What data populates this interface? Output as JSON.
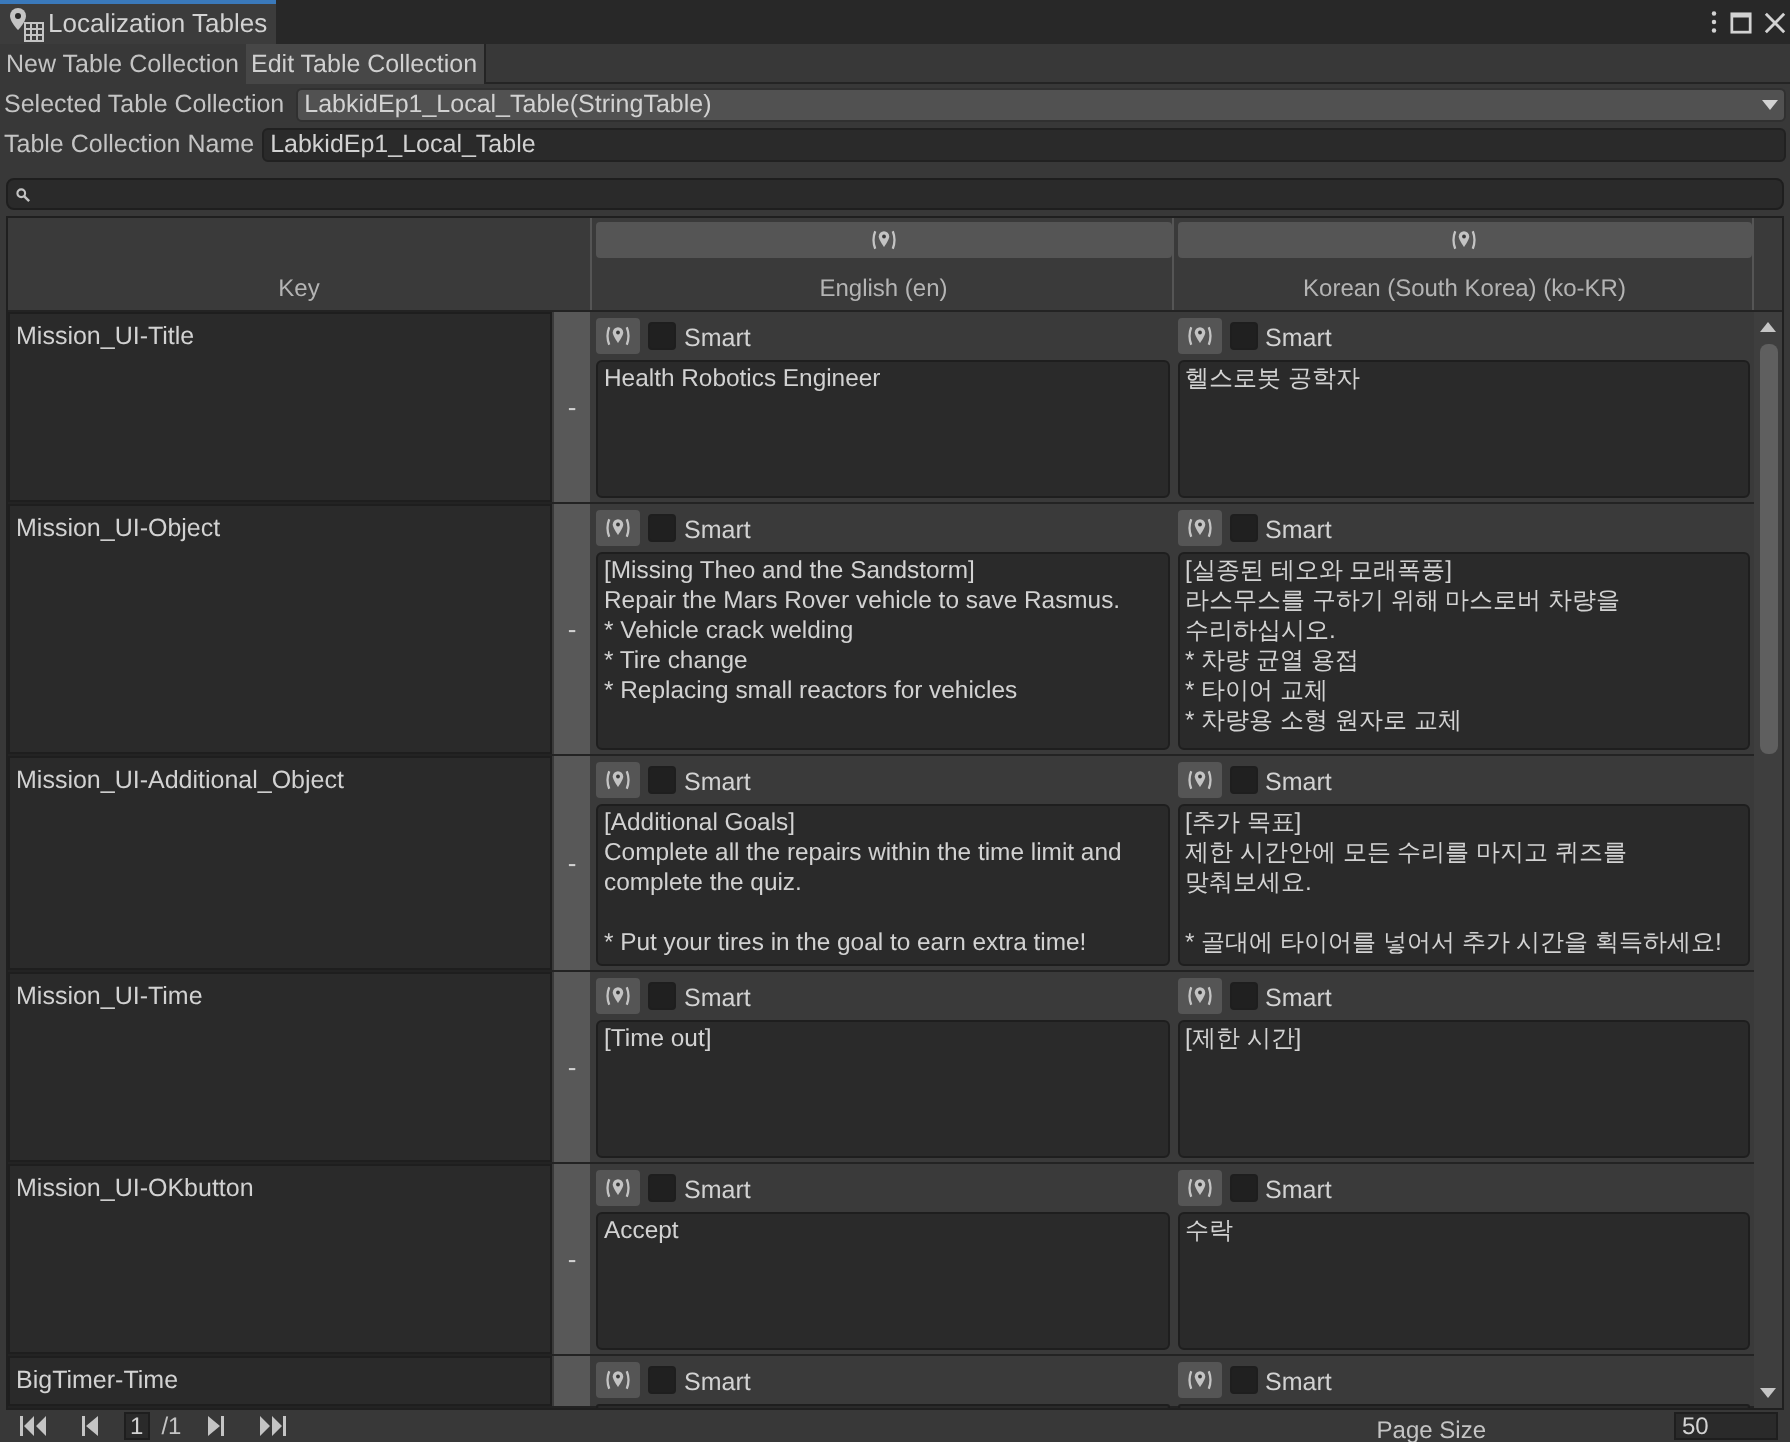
{
  "window": {
    "title": "Localization Tables"
  },
  "tabs": [
    {
      "label": "New Table Collection",
      "selected": false
    },
    {
      "label": "Edit Table Collection",
      "selected": true
    }
  ],
  "selected_collection": {
    "label": "Selected Table Collection",
    "value": "LabkidEp1_Local_Table(StringTable)"
  },
  "collection_name": {
    "label": "Table Collection Name",
    "value": "LabkidEp1_Local_Table"
  },
  "table": {
    "key_heading": "Key",
    "columns": [
      "English (en)",
      "Korean (South Korea) (ko-KR)"
    ],
    "rows": [
      {
        "key": "Mission_UI-Title",
        "remove": "-",
        "cells": [
          {
            "smart": false,
            "label": "Smart",
            "text": "Health Robotics Engineer"
          },
          {
            "smart": false,
            "label": "Smart",
            "text": "헬스로봇 공학자"
          }
        ]
      },
      {
        "key": "Mission_UI-Object",
        "remove": "-",
        "cells": [
          {
            "smart": false,
            "label": "Smart",
            "text": "[Missing Theo and the Sandstorm]\nRepair the Mars Rover vehicle to save Rasmus.\n* Vehicle crack welding\n* Tire change\n* Replacing small reactors for vehicles"
          },
          {
            "smart": false,
            "label": "Smart",
            "text": "[실종된 테오와 모래폭풍]\n라스무스를 구하기 위해 마스로버 차량을\n수리하십시오.\n* 차량 균열 용접\n* 타이어 교체\n* 차량용 소형 원자로 교체"
          }
        ]
      },
      {
        "key": "Mission_UI-Additional_Object",
        "remove": "-",
        "cells": [
          {
            "smart": false,
            "label": "Smart",
            "text": "[Additional Goals]\nComplete all the repairs within the time limit and complete the quiz.\n\n* Put your tires in the goal to earn extra time!"
          },
          {
            "smart": false,
            "label": "Smart",
            "text": "[추가 목표]\n제한 시간안에 모든 수리를 마지고 퀴즈를\n맞춰보세요.\n\n* 골대에 타이어를 넣어서 추가 시간을 획득하세요!"
          }
        ]
      },
      {
        "key": "Mission_UI-Time",
        "remove": "-",
        "cells": [
          {
            "smart": false,
            "label": "Smart",
            "text": "[Time out]"
          },
          {
            "smart": false,
            "label": "Smart",
            "text": "[제한 시간]"
          }
        ]
      },
      {
        "key": "Mission_UI-OKbutton",
        "remove": "-",
        "cells": [
          {
            "smart": false,
            "label": "Smart",
            "text": "Accept"
          },
          {
            "smart": false,
            "label": "Smart",
            "text": "수락"
          }
        ]
      },
      {
        "key": "BigTimer-Time",
        "cells": [
          {
            "smart": false,
            "label": "Smart"
          },
          {
            "smart": false,
            "label": "Smart"
          }
        ]
      }
    ]
  },
  "pager": {
    "page": "1",
    "total": "/1",
    "page_size_label": "Page Size",
    "page_size": "50"
  }
}
